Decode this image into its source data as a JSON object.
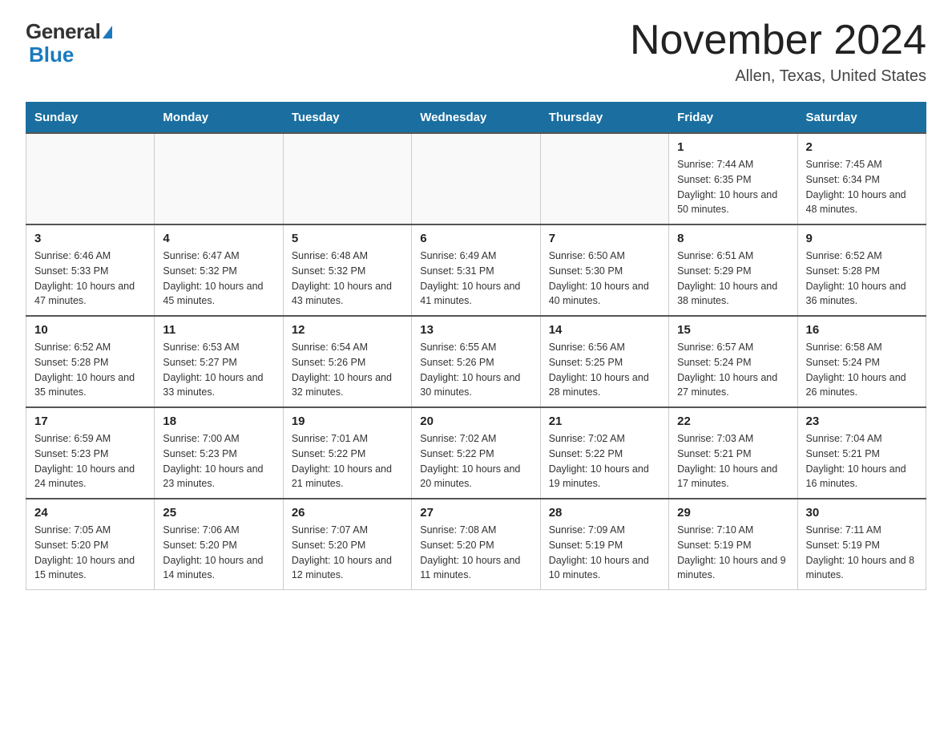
{
  "header": {
    "logo_general": "General",
    "logo_blue": "Blue",
    "month_title": "November 2024",
    "location": "Allen, Texas, United States"
  },
  "weekdays": [
    "Sunday",
    "Monday",
    "Tuesday",
    "Wednesday",
    "Thursday",
    "Friday",
    "Saturday"
  ],
  "weeks": [
    [
      {
        "day": "",
        "info": ""
      },
      {
        "day": "",
        "info": ""
      },
      {
        "day": "",
        "info": ""
      },
      {
        "day": "",
        "info": ""
      },
      {
        "day": "",
        "info": ""
      },
      {
        "day": "1",
        "info": "Sunrise: 7:44 AM\nSunset: 6:35 PM\nDaylight: 10 hours and 50 minutes."
      },
      {
        "day": "2",
        "info": "Sunrise: 7:45 AM\nSunset: 6:34 PM\nDaylight: 10 hours and 48 minutes."
      }
    ],
    [
      {
        "day": "3",
        "info": "Sunrise: 6:46 AM\nSunset: 5:33 PM\nDaylight: 10 hours and 47 minutes."
      },
      {
        "day": "4",
        "info": "Sunrise: 6:47 AM\nSunset: 5:32 PM\nDaylight: 10 hours and 45 minutes."
      },
      {
        "day": "5",
        "info": "Sunrise: 6:48 AM\nSunset: 5:32 PM\nDaylight: 10 hours and 43 minutes."
      },
      {
        "day": "6",
        "info": "Sunrise: 6:49 AM\nSunset: 5:31 PM\nDaylight: 10 hours and 41 minutes."
      },
      {
        "day": "7",
        "info": "Sunrise: 6:50 AM\nSunset: 5:30 PM\nDaylight: 10 hours and 40 minutes."
      },
      {
        "day": "8",
        "info": "Sunrise: 6:51 AM\nSunset: 5:29 PM\nDaylight: 10 hours and 38 minutes."
      },
      {
        "day": "9",
        "info": "Sunrise: 6:52 AM\nSunset: 5:28 PM\nDaylight: 10 hours and 36 minutes."
      }
    ],
    [
      {
        "day": "10",
        "info": "Sunrise: 6:52 AM\nSunset: 5:28 PM\nDaylight: 10 hours and 35 minutes."
      },
      {
        "day": "11",
        "info": "Sunrise: 6:53 AM\nSunset: 5:27 PM\nDaylight: 10 hours and 33 minutes."
      },
      {
        "day": "12",
        "info": "Sunrise: 6:54 AM\nSunset: 5:26 PM\nDaylight: 10 hours and 32 minutes."
      },
      {
        "day": "13",
        "info": "Sunrise: 6:55 AM\nSunset: 5:26 PM\nDaylight: 10 hours and 30 minutes."
      },
      {
        "day": "14",
        "info": "Sunrise: 6:56 AM\nSunset: 5:25 PM\nDaylight: 10 hours and 28 minutes."
      },
      {
        "day": "15",
        "info": "Sunrise: 6:57 AM\nSunset: 5:24 PM\nDaylight: 10 hours and 27 minutes."
      },
      {
        "day": "16",
        "info": "Sunrise: 6:58 AM\nSunset: 5:24 PM\nDaylight: 10 hours and 26 minutes."
      }
    ],
    [
      {
        "day": "17",
        "info": "Sunrise: 6:59 AM\nSunset: 5:23 PM\nDaylight: 10 hours and 24 minutes."
      },
      {
        "day": "18",
        "info": "Sunrise: 7:00 AM\nSunset: 5:23 PM\nDaylight: 10 hours and 23 minutes."
      },
      {
        "day": "19",
        "info": "Sunrise: 7:01 AM\nSunset: 5:22 PM\nDaylight: 10 hours and 21 minutes."
      },
      {
        "day": "20",
        "info": "Sunrise: 7:02 AM\nSunset: 5:22 PM\nDaylight: 10 hours and 20 minutes."
      },
      {
        "day": "21",
        "info": "Sunrise: 7:02 AM\nSunset: 5:22 PM\nDaylight: 10 hours and 19 minutes."
      },
      {
        "day": "22",
        "info": "Sunrise: 7:03 AM\nSunset: 5:21 PM\nDaylight: 10 hours and 17 minutes."
      },
      {
        "day": "23",
        "info": "Sunrise: 7:04 AM\nSunset: 5:21 PM\nDaylight: 10 hours and 16 minutes."
      }
    ],
    [
      {
        "day": "24",
        "info": "Sunrise: 7:05 AM\nSunset: 5:20 PM\nDaylight: 10 hours and 15 minutes."
      },
      {
        "day": "25",
        "info": "Sunrise: 7:06 AM\nSunset: 5:20 PM\nDaylight: 10 hours and 14 minutes."
      },
      {
        "day": "26",
        "info": "Sunrise: 7:07 AM\nSunset: 5:20 PM\nDaylight: 10 hours and 12 minutes."
      },
      {
        "day": "27",
        "info": "Sunrise: 7:08 AM\nSunset: 5:20 PM\nDaylight: 10 hours and 11 minutes."
      },
      {
        "day": "28",
        "info": "Sunrise: 7:09 AM\nSunset: 5:19 PM\nDaylight: 10 hours and 10 minutes."
      },
      {
        "day": "29",
        "info": "Sunrise: 7:10 AM\nSunset: 5:19 PM\nDaylight: 10 hours and 9 minutes."
      },
      {
        "day": "30",
        "info": "Sunrise: 7:11 AM\nSunset: 5:19 PM\nDaylight: 10 hours and 8 minutes."
      }
    ]
  ]
}
